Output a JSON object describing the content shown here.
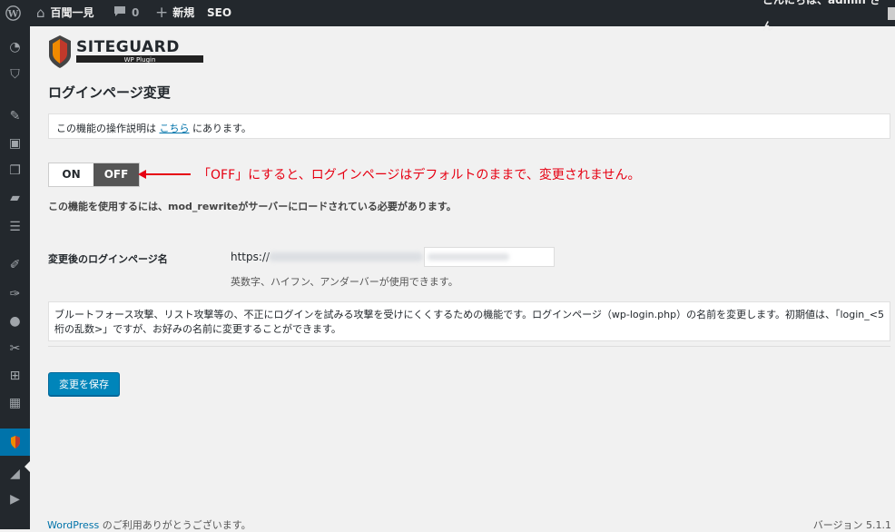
{
  "adminbar": {
    "site_name": "百聞一見",
    "comments_count": "0",
    "new_label": "新規",
    "seo_label": "SEO",
    "greeting": "こんにちは、admin さん"
  },
  "logo": {
    "brand": "SITEGUARD",
    "subtitle": "WP Plugin"
  },
  "page": {
    "title": "ログインページ変更",
    "notice_prefix": "この機能の操作説明は",
    "notice_link": "こちら",
    "notice_suffix": "にあります。",
    "toggle_on": "ON",
    "toggle_off": "OFF",
    "annotation": "「OFF」にすると、ログインページはデフォルトのままで、変更されません。",
    "requirement": "この機能を使用するには、mod_rewriteがサーバーにロードされている必要があります。",
    "field_label": "変更後のログインページ名",
    "url_prefix": "https://",
    "field_hint": "英数字、ハイフン、アンダーバーが使用できます。",
    "description": "ブルートフォース攻撃、リスト攻撃等の、不正にログインを試みる攻撃を受けにくくするための機能です。ログインページ（wp-login.php）の名前を変更します。初期値は、「login_<5桁の乱数>」ですが、お好みの名前に変更することができます。",
    "save_label": "変更を保存"
  },
  "footer": {
    "wp_link": "WordPress",
    "thanks": " のご利用ありがとうございます。",
    "version": "バージョン 5.1.1"
  },
  "colors": {
    "adminbar_bg": "#23282d",
    "accent": "#0073aa",
    "annotation": "#e60012",
    "button": "#0085ba"
  }
}
